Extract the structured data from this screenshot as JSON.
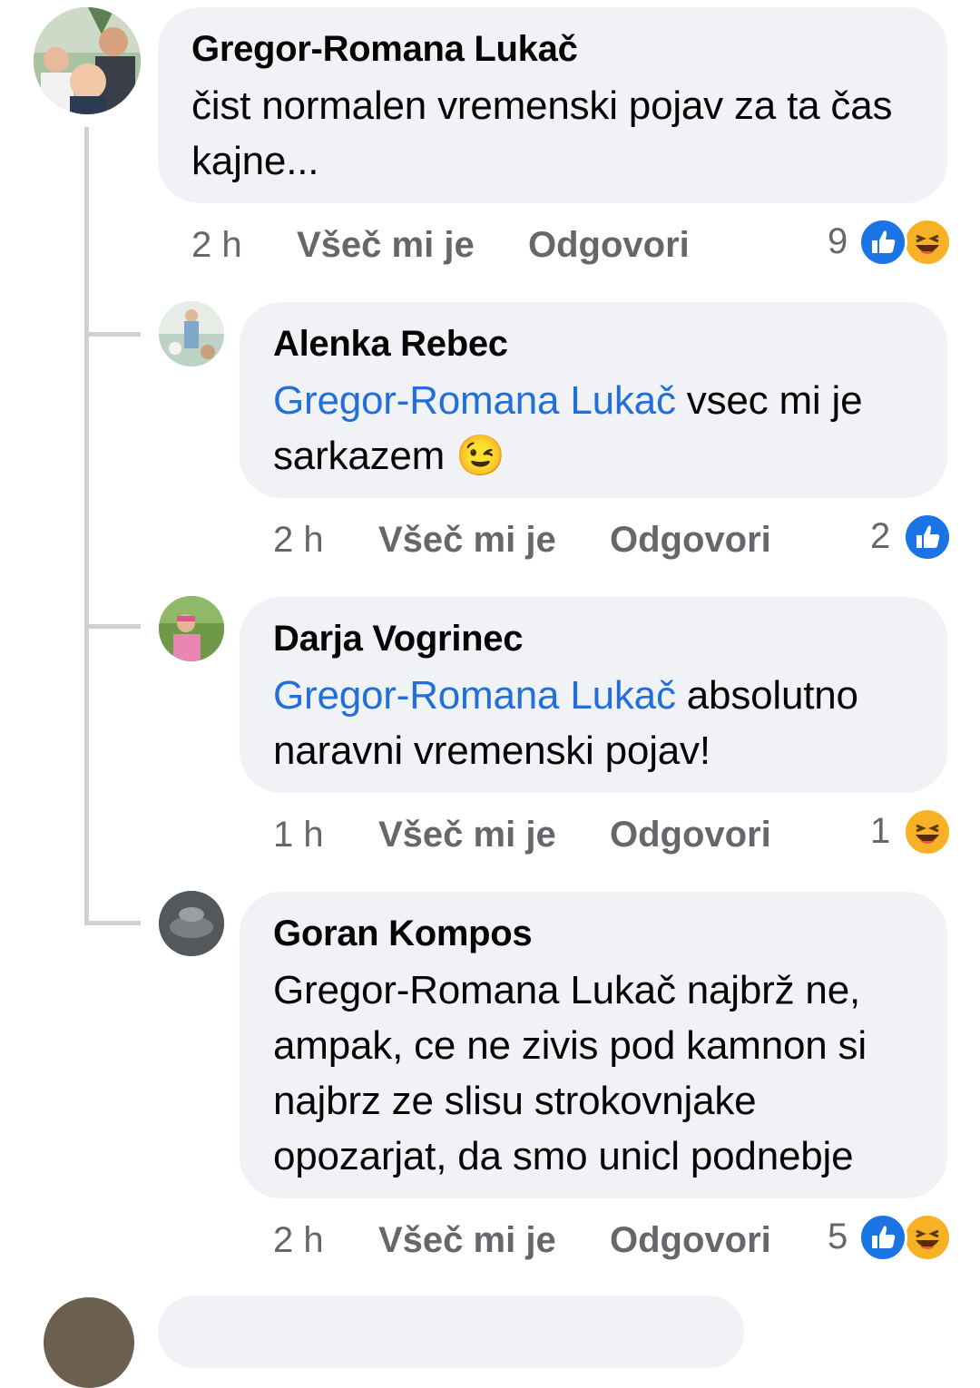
{
  "comments": [
    {
      "author": "Gregor-Romana Lukač",
      "mention": "",
      "text": "čist normalen vremenski pojav za ta čas kajne...",
      "time": "2 h",
      "like_label": "Všeč mi je",
      "reply_label": "Odgovori",
      "reaction_count": "9",
      "reactions": [
        "like-icon",
        "haha-icon"
      ]
    },
    {
      "author": "Alenka Rebec",
      "mention": "Gregor-Romana Lukač",
      "text": "vsec mi je sarkazem 😉",
      "time": "2 h",
      "like_label": "Všeč mi je",
      "reply_label": "Odgovori",
      "reaction_count": "2",
      "reactions": [
        "like-icon"
      ]
    },
    {
      "author": "Darja Vogrinec",
      "mention": "Gregor-Romana Lukač",
      "text": "absolutno naravni vremenski pojav!",
      "time": "1 h",
      "like_label": "Všeč mi je",
      "reply_label": "Odgovori",
      "reaction_count": "1",
      "reactions": [
        "haha-icon"
      ]
    },
    {
      "author": "Goran Kompos",
      "mention": "",
      "text": "Gregor-Romana Lukač najbrž ne, ampak, ce ne zivis pod kamnon si najbrz ze slisu strokovnjake opozarjat, da smo unicl podnebje",
      "time": "2 h",
      "like_label": "Všeč mi je",
      "reply_label": "Odgovori",
      "reaction_count": "5",
      "reactions": [
        "like-icon",
        "haha-icon"
      ]
    }
  ],
  "colors": {
    "bubble": "#f0f2f5",
    "mention": "#216fdb",
    "meta": "#65676b",
    "like": "#1b74e4",
    "haha": "#f7b125"
  }
}
